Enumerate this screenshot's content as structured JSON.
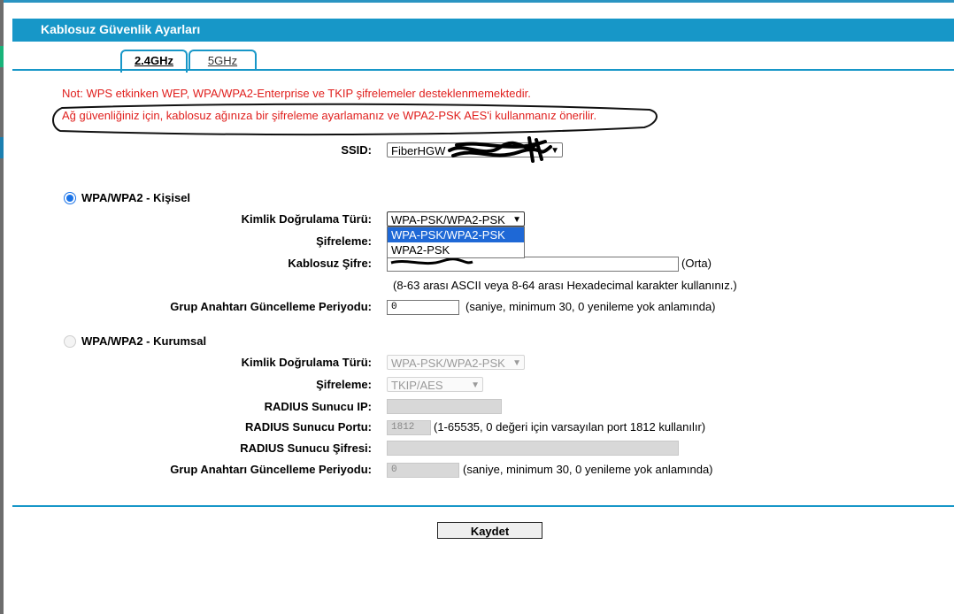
{
  "header": {
    "title": "Kablosuz Güvenlik Ayarları"
  },
  "tabs": [
    {
      "label": "2.4GHz",
      "active": true
    },
    {
      "label": "5GHz",
      "active": false
    }
  ],
  "notes": [
    "Not: WPS etkinken WEP, WPA/WPA2-Enterprise ve TKIP şifrelemeler desteklenmemektedir.",
    "Ağ güvenliğiniz için, kablosuz ağınıza bir şifreleme ayarlamanız ve WPA2-PSK AES'i kullanmanız önerilir."
  ],
  "ssid": {
    "label": "SSID:",
    "value": "FiberHGW"
  },
  "personal": {
    "title": "WPA/WPA2 - Kişisel",
    "selected": true,
    "auth_label": "Kimlik Doğrulama Türü:",
    "auth_value": "WPA-PSK/WPA2-PSK",
    "auth_options": [
      "WPA-PSK/WPA2-PSK",
      "WPA2-PSK"
    ],
    "enc_label": "Şifreleme:",
    "pass_label": "Kablosuz Şifre:",
    "pass_strength": "(Orta)",
    "pass_hint": "(8-63 arası ASCII veya 8-64 arası Hexadecimal karakter kullanınız.)",
    "group_label": "Grup Anahtarı Güncelleme Periyodu:",
    "group_value": "0",
    "group_hint": "(saniye, minimum 30, 0 yenileme yok anlamında)"
  },
  "enterprise": {
    "title": "WPA/WPA2 - Kurumsal",
    "selected": false,
    "auth_label": "Kimlik Doğrulama Türü:",
    "auth_value": "WPA-PSK/WPA2-PSK",
    "enc_label": "Şifreleme:",
    "enc_value": "TKIP/AES",
    "radius_ip_label": "RADIUS Sunucu IP:",
    "radius_port_label": "RADIUS Sunucu Portu:",
    "radius_port_value": "1812",
    "radius_port_hint": "(1-65535, 0 değeri için varsayılan port 1812 kullanılır)",
    "radius_secret_label": "RADIUS Sunucu Şifresi:",
    "group_label": "Grup Anahtarı Güncelleme Periyodu:",
    "group_value": "0",
    "group_hint": "(saniye, minimum 30, 0 yenileme yok anlamında)"
  },
  "save_button": "Kaydet",
  "icons": {
    "dropdown": "chevron-down-icon"
  },
  "colors": {
    "accent": "#1797c8",
    "note": "#e0201e",
    "selection": "#1e68d6"
  }
}
